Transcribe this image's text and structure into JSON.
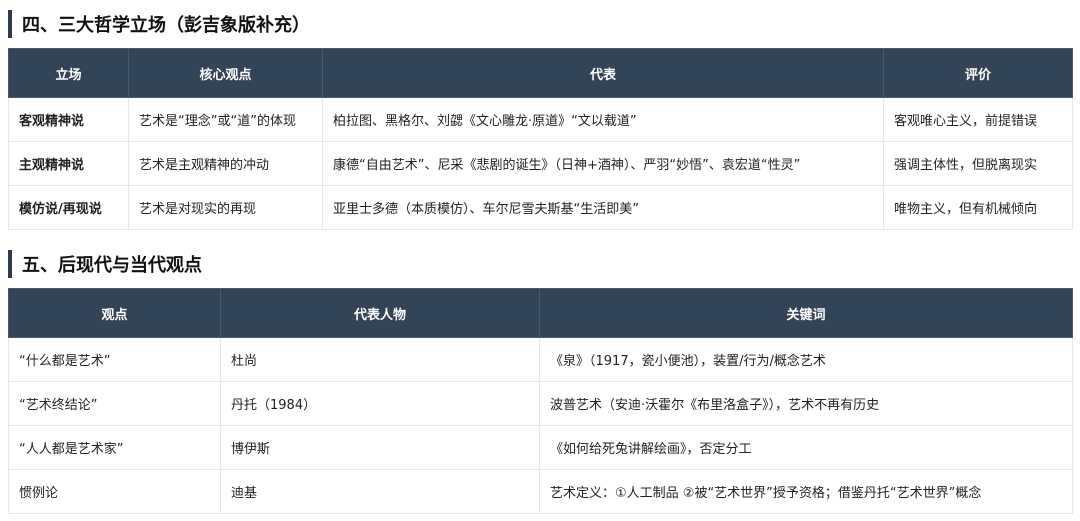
{
  "section4": {
    "title": "四、三大哲学立场（彭吉象版补充）",
    "headers": [
      "立场",
      "核心观点",
      "代表",
      "评价"
    ],
    "rows": [
      [
        "客观精神说",
        "艺术是“理念”或“道”的体现",
        "柏拉图、黑格尔、刘勰《文心雕龙·原道》“文以载道”",
        "客观唯心主义，前提错误"
      ],
      [
        "主观精神说",
        "艺术是主观精神的冲动",
        "康德“自由艺术”、尼采《悲剧的诞生》（日神+酒神）、严羽“妙悟”、袁宏道“性灵”",
        "强调主体性，但脱离现实"
      ],
      [
        "模仿说/再现说",
        "艺术是对现实的再现",
        "亚里士多德（本质模仿）、车尔尼雪夫斯基“生活即美”",
        "唯物主义，但有机械倾向"
      ]
    ]
  },
  "section5": {
    "title": "五、后现代与当代观点",
    "headers": [
      "观点",
      "代表人物",
      "关键词"
    ],
    "rows": [
      [
        "“什么都是艺术”",
        "杜尚",
        "《泉》（1917，瓷小便池），装置/行为/概念艺术"
      ],
      [
        "“艺术终结论”",
        "丹托（1984）",
        "波普艺术（安迪·沃霍尔《布里洛盒子》），艺术不再有历史"
      ],
      [
        "“人人都是艺术家”",
        "博伊斯",
        "《如何给死兔讲解绘画》，否定分工"
      ],
      [
        "惯例论",
        "迪基",
        "艺术定义：①人工制品 ②被“艺术世界”授予资格；借鉴丹托“艺术世界”概念"
      ]
    ]
  }
}
